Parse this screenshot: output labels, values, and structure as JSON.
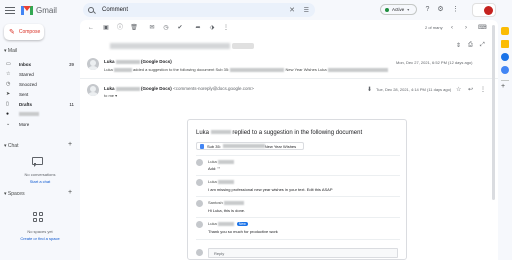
{
  "app": {
    "name": "Gmail"
  },
  "search": {
    "query": "Comment"
  },
  "status": {
    "label": "Active"
  },
  "sidebar": {
    "compose_label": "Compose",
    "mail_section": "Mail",
    "items": [
      {
        "icon": "inbox-icon",
        "label": "Inbox",
        "count": "39"
      },
      {
        "icon": "star-icon",
        "label": "Starred",
        "count": ""
      },
      {
        "icon": "snooze-icon",
        "label": "Snoozed",
        "count": ""
      },
      {
        "icon": "send-icon",
        "label": "Sent",
        "count": ""
      },
      {
        "icon": "draft-icon",
        "label": "Drafts",
        "count": "11"
      },
      {
        "icon": "label-icon",
        "label": "",
        "count": ""
      },
      {
        "icon": "chevron-down-icon",
        "label": "More",
        "count": ""
      }
    ],
    "chat_section": "Chat",
    "no_conversations": "No conversations",
    "start_chat": "Start a chat",
    "spaces_section": "Spaces",
    "no_spaces": "No spaces yet",
    "create_space": "Create or find a space"
  },
  "toolbar": {
    "pager": "2 of many"
  },
  "messages": [
    {
      "sender": "Luka",
      "sender_suffix": "(Google Docs)",
      "snippet_start": "Luka",
      "snippet_mid": "added a suggestion to the following document Sub 35:",
      "snippet_end": "New Year Wishes Luka",
      "date": "Mon, Dec 27, 2021, 6:52 PM (12 days ago)"
    },
    {
      "sender": "Luka",
      "sender_suffix": "(Google Docs)",
      "email": "<comments-noreply@docs.google.com>",
      "to": "to me",
      "date": "Tue, Dec 28, 2021, 4:14 PM (11 days ago)"
    }
  ],
  "card": {
    "title_start": "Luka",
    "title_end": "replied to a suggestion in the following document",
    "doc_prefix": "Sub 35:",
    "doc_suffix": "New Year Wishes",
    "comments": [
      {
        "name": "Luka",
        "text": "Add: \"\""
      },
      {
        "name": "Luka",
        "text": "I am missing professional new year wishes in your text. Edit this ASAP"
      },
      {
        "name": "Santosh",
        "text": "Hi Luka, this is done."
      },
      {
        "name": "Luka",
        "text": "Thank you so much for productive work",
        "badge": "New"
      }
    ],
    "reply_placeholder": "Reply"
  }
}
